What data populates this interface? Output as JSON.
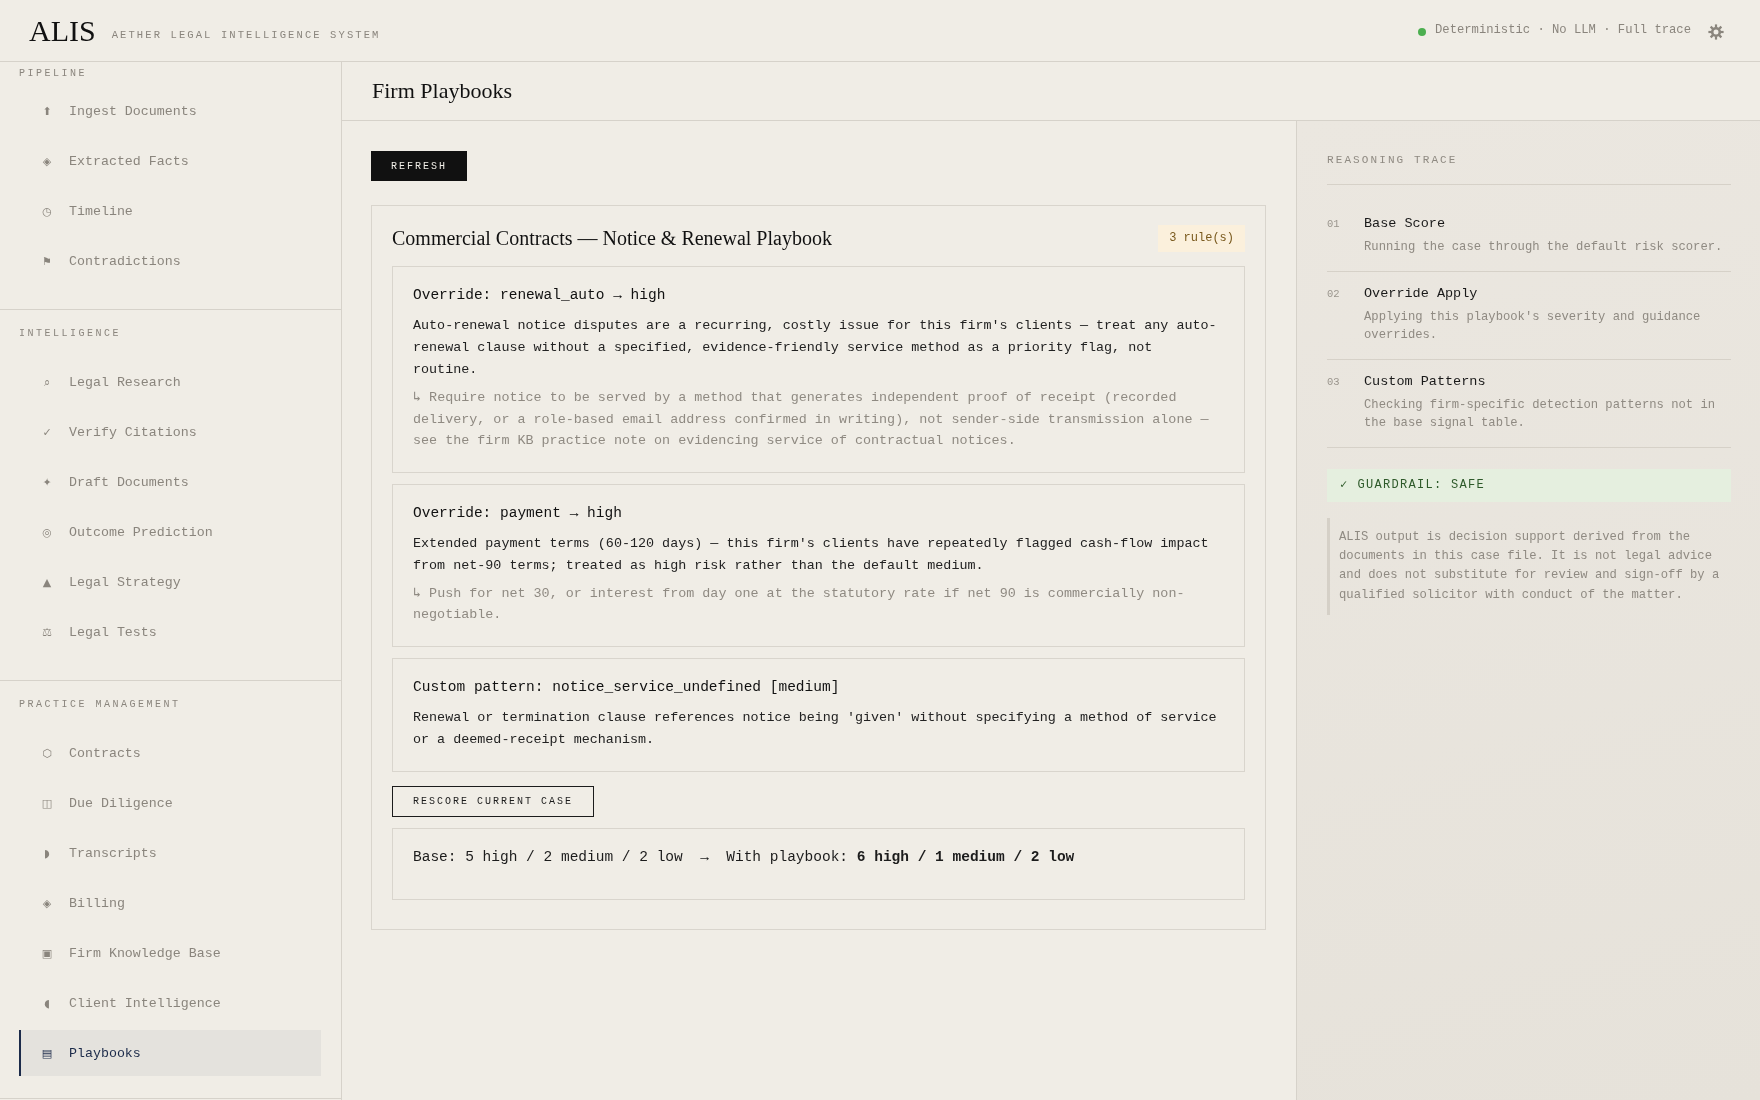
{
  "header": {
    "logo": "ALIS",
    "tagline": "AETHER LEGAL INTELLIGENCE SYSTEM",
    "status_text": "Deterministic · No LLM · Full trace"
  },
  "sidebar": {
    "sections": [
      {
        "label": "PIPELINE",
        "items": [
          {
            "icon": "⬆",
            "label": "Ingest Documents",
            "selected": false
          },
          {
            "icon": "◈",
            "label": "Extracted Facts",
            "selected": false
          },
          {
            "icon": "◷",
            "label": "Timeline",
            "selected": false
          },
          {
            "icon": "⚑",
            "label": "Contradictions",
            "selected": false
          }
        ]
      },
      {
        "label": "INTELLIGENCE",
        "items": [
          {
            "icon": "⌕",
            "label": "Legal Research",
            "selected": false
          },
          {
            "icon": "✓",
            "label": "Verify Citations",
            "selected": false
          },
          {
            "icon": "✦",
            "label": "Draft Documents",
            "selected": false
          },
          {
            "icon": "◎",
            "label": "Outcome Prediction",
            "selected": false
          },
          {
            "icon": "▲",
            "label": "Legal Strategy",
            "selected": false
          },
          {
            "icon": "⚖",
            "label": "Legal Tests",
            "selected": false
          }
        ]
      },
      {
        "label": "PRACTICE MANAGEMENT",
        "items": [
          {
            "icon": "⬡",
            "label": "Contracts",
            "selected": false
          },
          {
            "icon": "◫",
            "label": "Due Diligence",
            "selected": false
          },
          {
            "icon": "◗",
            "label": "Transcripts",
            "selected": false
          },
          {
            "icon": "◈",
            "label": "Billing",
            "selected": false
          },
          {
            "icon": "▣",
            "label": "Firm Knowledge Base",
            "selected": false
          },
          {
            "icon": "◖",
            "label": "Client Intelligence",
            "selected": false
          },
          {
            "icon": "▤",
            "label": "Playbooks",
            "selected": true
          }
        ]
      }
    ]
  },
  "page": {
    "title": "Firm Playbooks",
    "refresh_button": "REFRESH",
    "playbook": {
      "title": "Commercial Contracts — Notice & Renewal Playbook",
      "rule_count": "3 rule(s)",
      "rules": [
        {
          "title": "Override: renewal_auto → high",
          "description": "Auto-renewal notice disputes are a recurring, costly issue for this firm's clients — treat any auto-renewal clause without a specified, evidence-friendly service method as a priority flag, not routine.",
          "guidance": "↳ Require notice to be served by a method that generates independent proof of receipt (recorded delivery, or a role-based email address confirmed in writing), not sender-side transmission alone — see the firm KB practice note on evidencing service of contractual notices."
        },
        {
          "title": "Override: payment → high",
          "description": "Extended payment terms (60-120 days) — this firm's clients have repeatedly flagged cash-flow impact from net-90 terms; treated as high risk rather than the default medium.",
          "guidance": "↳ Push for net 30, or interest from day one at the statutory rate if net 90 is commercially non-negotiable."
        },
        {
          "title": "Custom pattern: notice_service_undefined [medium]",
          "description": "Renewal or termination clause references notice being 'given' without specifying a method of service or a deemed-receipt mechanism."
        }
      ],
      "rescore_button": "RESCORE CURRENT CASE",
      "result": "Base: 5 high / 2 medium / 2 low  →  With playbook: **6 high / 1 medium / 2 low**"
    }
  },
  "trace": {
    "title": "REASONING TRACE",
    "steps": [
      {
        "number": "01",
        "title": "Base Score",
        "description": "Running the case through the default risk scorer."
      },
      {
        "number": "02",
        "title": "Override Apply",
        "description": "Applying this playbook's severity and guidance overrides."
      },
      {
        "number": "03",
        "title": "Custom Patterns",
        "description": "Checking firm-specific detection patterns not in the base signal table."
      }
    ],
    "guardrail": {
      "icon": "✓",
      "label": "GUARDRAIL: SAFE"
    },
    "disclaimer": "ALIS output is decision support derived from the documents in this case file. It is not legal advice and does not substitute for review and sign-off by a qualified solicitor with conduct of the matter."
  }
}
